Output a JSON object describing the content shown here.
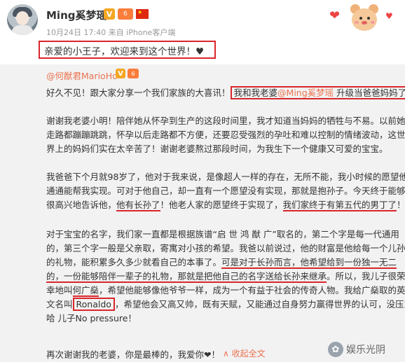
{
  "post": {
    "username": "Ming奚梦瑶",
    "badge_v": "V",
    "badge_vip": "6",
    "time": "10月24日 17:40 来自 iPhone客户端",
    "caption": "亲爱的小王子，欢迎来到这个世界！"
  },
  "repost": {
    "username": "@何猷君MarioHo",
    "badge_v": "V",
    "badge_vip": "6",
    "p1_a": "好久不见！跟大家分享一个我们家族的大喜讯！",
    "p1_b": "我和我老婆",
    "p1_mention": "@Ming奚梦瑶",
    "p1_c": " 升级当爸爸妈妈了",
    "p2_l1": "谢谢我老婆小明！陪伴她从怀孕到生产的这段时间里，我才知道当妈妈的牺牲与不易。以前她",
    "p2_l2": "走路都蹦蹦跳跳，怀孕以后走路都不方便，还要忍受强烈的孕吐和难以控制的情绪波动，这世",
    "p2_l3": "界上的妈妈们实在太辛苦了！谢谢老婆熬过那段时间，为我生下一个健康又可爱的宝宝。",
    "p3_l1": "我爸爸下个月就98岁了，他对于我来说，是像超人一样的存在，无所不能，我小时候的愿望他",
    "p3_l2": "通通能帮我实现。可对于他自己，却一直有一个愿望没有实现，那就是抱孙子。今天终于能够",
    "p3_l3a": "很高兴地告诉他，",
    "p3_l3b": "他有长孙了",
    "p3_l3c": "！他老人家的愿望终于实现了，",
    "p3_l3d": "我们家终于有第五代的男丁了",
    "p3_l3e": "！",
    "p4_l1": "对于宝宝的名字，我们家一直都是根据族谱“启 世 鸿 猷 广”取名的，第二个字是每一代通用",
    "p4_l2": "的，第三个字一般是父亲取，寄寓对小孩的希望。我爸以前说过，他的财富是他给每一个儿孙",
    "p4_l3a": "的礼物，能积累多久多少就看自己的本事了。",
    "p4_l3b": "可是对于长孙而言，他希望给到一份独一无二",
    "p4_l4a": "的，一份能够陪伴一辈子的礼物",
    "p4_l4b": "，那就是把他自己的名字送给长孙来继承",
    "p4_l4c": "。所以，我儿子很荣",
    "p4_l5a": "幸地叫",
    "p4_l5b": "何广燊",
    "p4_l5c": "，希望他能够像他爷爷一样，成为一个有益于社会的传奇人物。我给广燊取的英",
    "p4_l6a": "文名叫",
    "p4_l6b": "Ronaldo",
    "p4_l6c": "，希望他会又高又帅，既有天赋，又能通过自身努力赢得世界的认可，没压力",
    "p4_l7": "哈 儿子No pressure！",
    "footer": "再次谢谢我的老婆，你是最棒的，我爱你❤！",
    "collapse": "∧ 收起全文"
  },
  "watermark": {
    "text": "娱乐光阴"
  }
}
